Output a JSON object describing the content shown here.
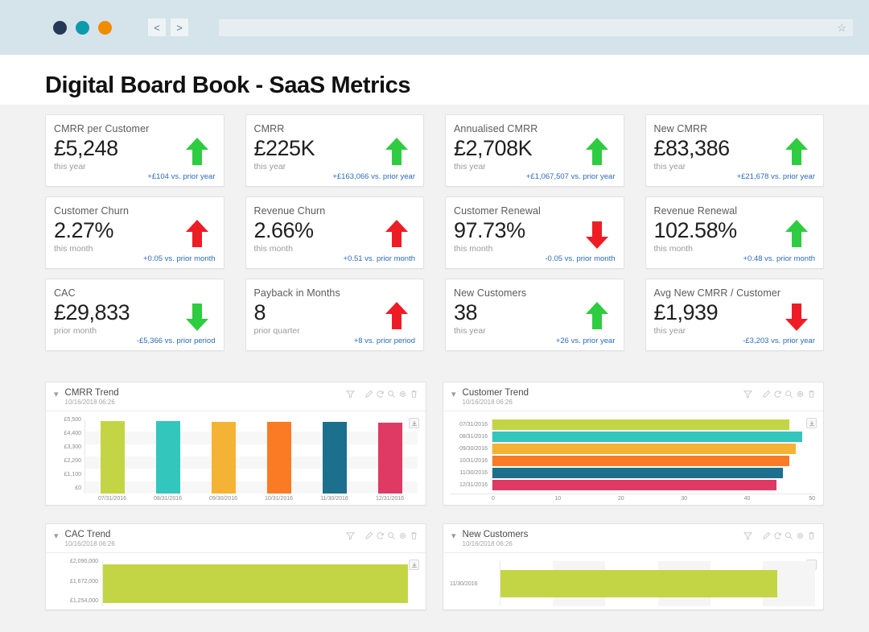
{
  "browser": {
    "dots": [
      "navy",
      "teal",
      "amber"
    ],
    "back_label": "<",
    "forward_label": ">",
    "address_value": "",
    "star_glyph": "☆"
  },
  "header": {
    "title": "Digital Board Book - SaaS Metrics"
  },
  "colors": {
    "positive_arrow": "#2ecc40",
    "negative_arrow": "#ee1c25",
    "delta_text": "#2b6cb8",
    "series": [
      "#c3d545",
      "#32c6bd",
      "#f5b335",
      "#fb7a24",
      "#1d6f8e",
      "#de3a63"
    ]
  },
  "kpis": [
    {
      "label": "CMRR per Customer",
      "value": "£5,248",
      "period": "this year",
      "delta": "+£104 vs. prior year",
      "arrow": "up",
      "arrow_color": "green"
    },
    {
      "label": "CMRR",
      "value": "£225K",
      "period": "this year",
      "delta": "+£163,066 vs. prior year",
      "arrow": "up",
      "arrow_color": "green"
    },
    {
      "label": "Annualised CMRR",
      "value": "£2,708K",
      "period": "this year",
      "delta": "+£1,067,507 vs. prior year",
      "arrow": "up",
      "arrow_color": "green"
    },
    {
      "label": "New CMRR",
      "value": "£83,386",
      "period": "this year",
      "delta": "+£21,678 vs. prior year",
      "arrow": "up",
      "arrow_color": "green"
    },
    {
      "label": "Customer Churn",
      "value": "2.27%",
      "period": "this month",
      "delta": "+0.05 vs. prior month",
      "arrow": "up",
      "arrow_color": "red"
    },
    {
      "label": "Revenue Churn",
      "value": "2.66%",
      "period": "this month",
      "delta": "+0.51 vs. prior month",
      "arrow": "up",
      "arrow_color": "red"
    },
    {
      "label": "Customer Renewal",
      "value": "97.73%",
      "period": "this month",
      "delta": "-0.05 vs. prior month",
      "arrow": "down",
      "arrow_color": "red"
    },
    {
      "label": "Revenue Renewal",
      "value": "102.58%",
      "period": "this month",
      "delta": "+0.48 vs. prior month",
      "arrow": "up",
      "arrow_color": "green"
    },
    {
      "label": "CAC",
      "value": "£29,833",
      "period": "prior month",
      "delta": "-£5,366 vs. prior period",
      "arrow": "down",
      "arrow_color": "green"
    },
    {
      "label": "Payback in Months",
      "value": "8",
      "period": "prior quarter",
      "delta": "+8 vs. prior period",
      "arrow": "up",
      "arrow_color": "red"
    },
    {
      "label": "New Customers",
      "value": "38",
      "period": "this year",
      "delta": "+26 vs. prior year",
      "arrow": "up",
      "arrow_color": "green"
    },
    {
      "label": "Avg New CMRR / Customer",
      "value": "£1,939",
      "period": "this year",
      "delta": "-£3,203 vs. prior year",
      "arrow": "down",
      "arrow_color": "red"
    }
  ],
  "panel_tools": [
    "filter-icon",
    "pencil-icon",
    "refresh-icon",
    "search-icon",
    "gear-icon",
    "trash-icon"
  ],
  "panels": [
    {
      "title": "CMRR Trend",
      "timestamp": "10/16/2018 06:26"
    },
    {
      "title": "Customer Trend",
      "timestamp": "10/16/2018 06:26"
    },
    {
      "title": "CAC Trend",
      "timestamp": "10/16/2018 06:26"
    },
    {
      "title": "New Customers",
      "timestamp": "10/16/2018 06:26"
    }
  ],
  "chart_data": [
    {
      "type": "bar",
      "title": "CMRR Trend",
      "categories": [
        "07/31/2016",
        "08/31/2016",
        "09/30/2016",
        "10/31/2016",
        "11/30/2016",
        "12/31/2016"
      ],
      "values": [
        5400,
        5400,
        5330,
        5330,
        5330,
        5270
      ],
      "ytick_labels": [
        "£5,500",
        "£4,400",
        "£3,300",
        "£2,200",
        "£1,100",
        "£0"
      ],
      "ylim": [
        0,
        5500
      ],
      "xlabel": "",
      "ylabel": "",
      "grid": true,
      "legend": false,
      "colors": [
        "#c3d545",
        "#32c6bd",
        "#f5b335",
        "#fb7a24",
        "#1d6f8e",
        "#de3a63"
      ]
    },
    {
      "type": "bar",
      "orientation": "horizontal",
      "title": "Customer Trend",
      "categories": [
        "07/31/2016",
        "08/31/2016",
        "09/30/2016",
        "10/31/2016",
        "11/30/2016",
        "12/31/2016"
      ],
      "values": [
        46,
        48,
        47,
        46,
        45,
        44
      ],
      "xtick_labels": [
        "0",
        "10",
        "20",
        "30",
        "40",
        "50"
      ],
      "xlim": [
        0,
        50
      ],
      "xlabel": "",
      "ylabel": "",
      "grid": false,
      "legend": false,
      "colors": [
        "#c3d545",
        "#32c6bd",
        "#f5b335",
        "#fb7a24",
        "#1d6f8e",
        "#de3a63"
      ]
    },
    {
      "type": "bar",
      "title": "CAC Trend",
      "categories": [
        ""
      ],
      "values": [
        2090000
      ],
      "ytick_labels": [
        "£2,090,000",
        "£1,672,000",
        "£1,254,000"
      ],
      "ylim": [
        0,
        2090000
      ],
      "xlabel": "",
      "ylabel": "",
      "grid": false,
      "legend": false,
      "colors": [
        "#c3d545"
      ]
    },
    {
      "type": "bar",
      "orientation": "horizontal",
      "title": "New Customers",
      "categories": [
        "11/30/2016"
      ],
      "values": [
        88
      ],
      "xlim": [
        0,
        100
      ],
      "xlabel": "",
      "ylabel": "",
      "grid": true,
      "legend": false,
      "colors": [
        "#c3d545"
      ]
    }
  ]
}
